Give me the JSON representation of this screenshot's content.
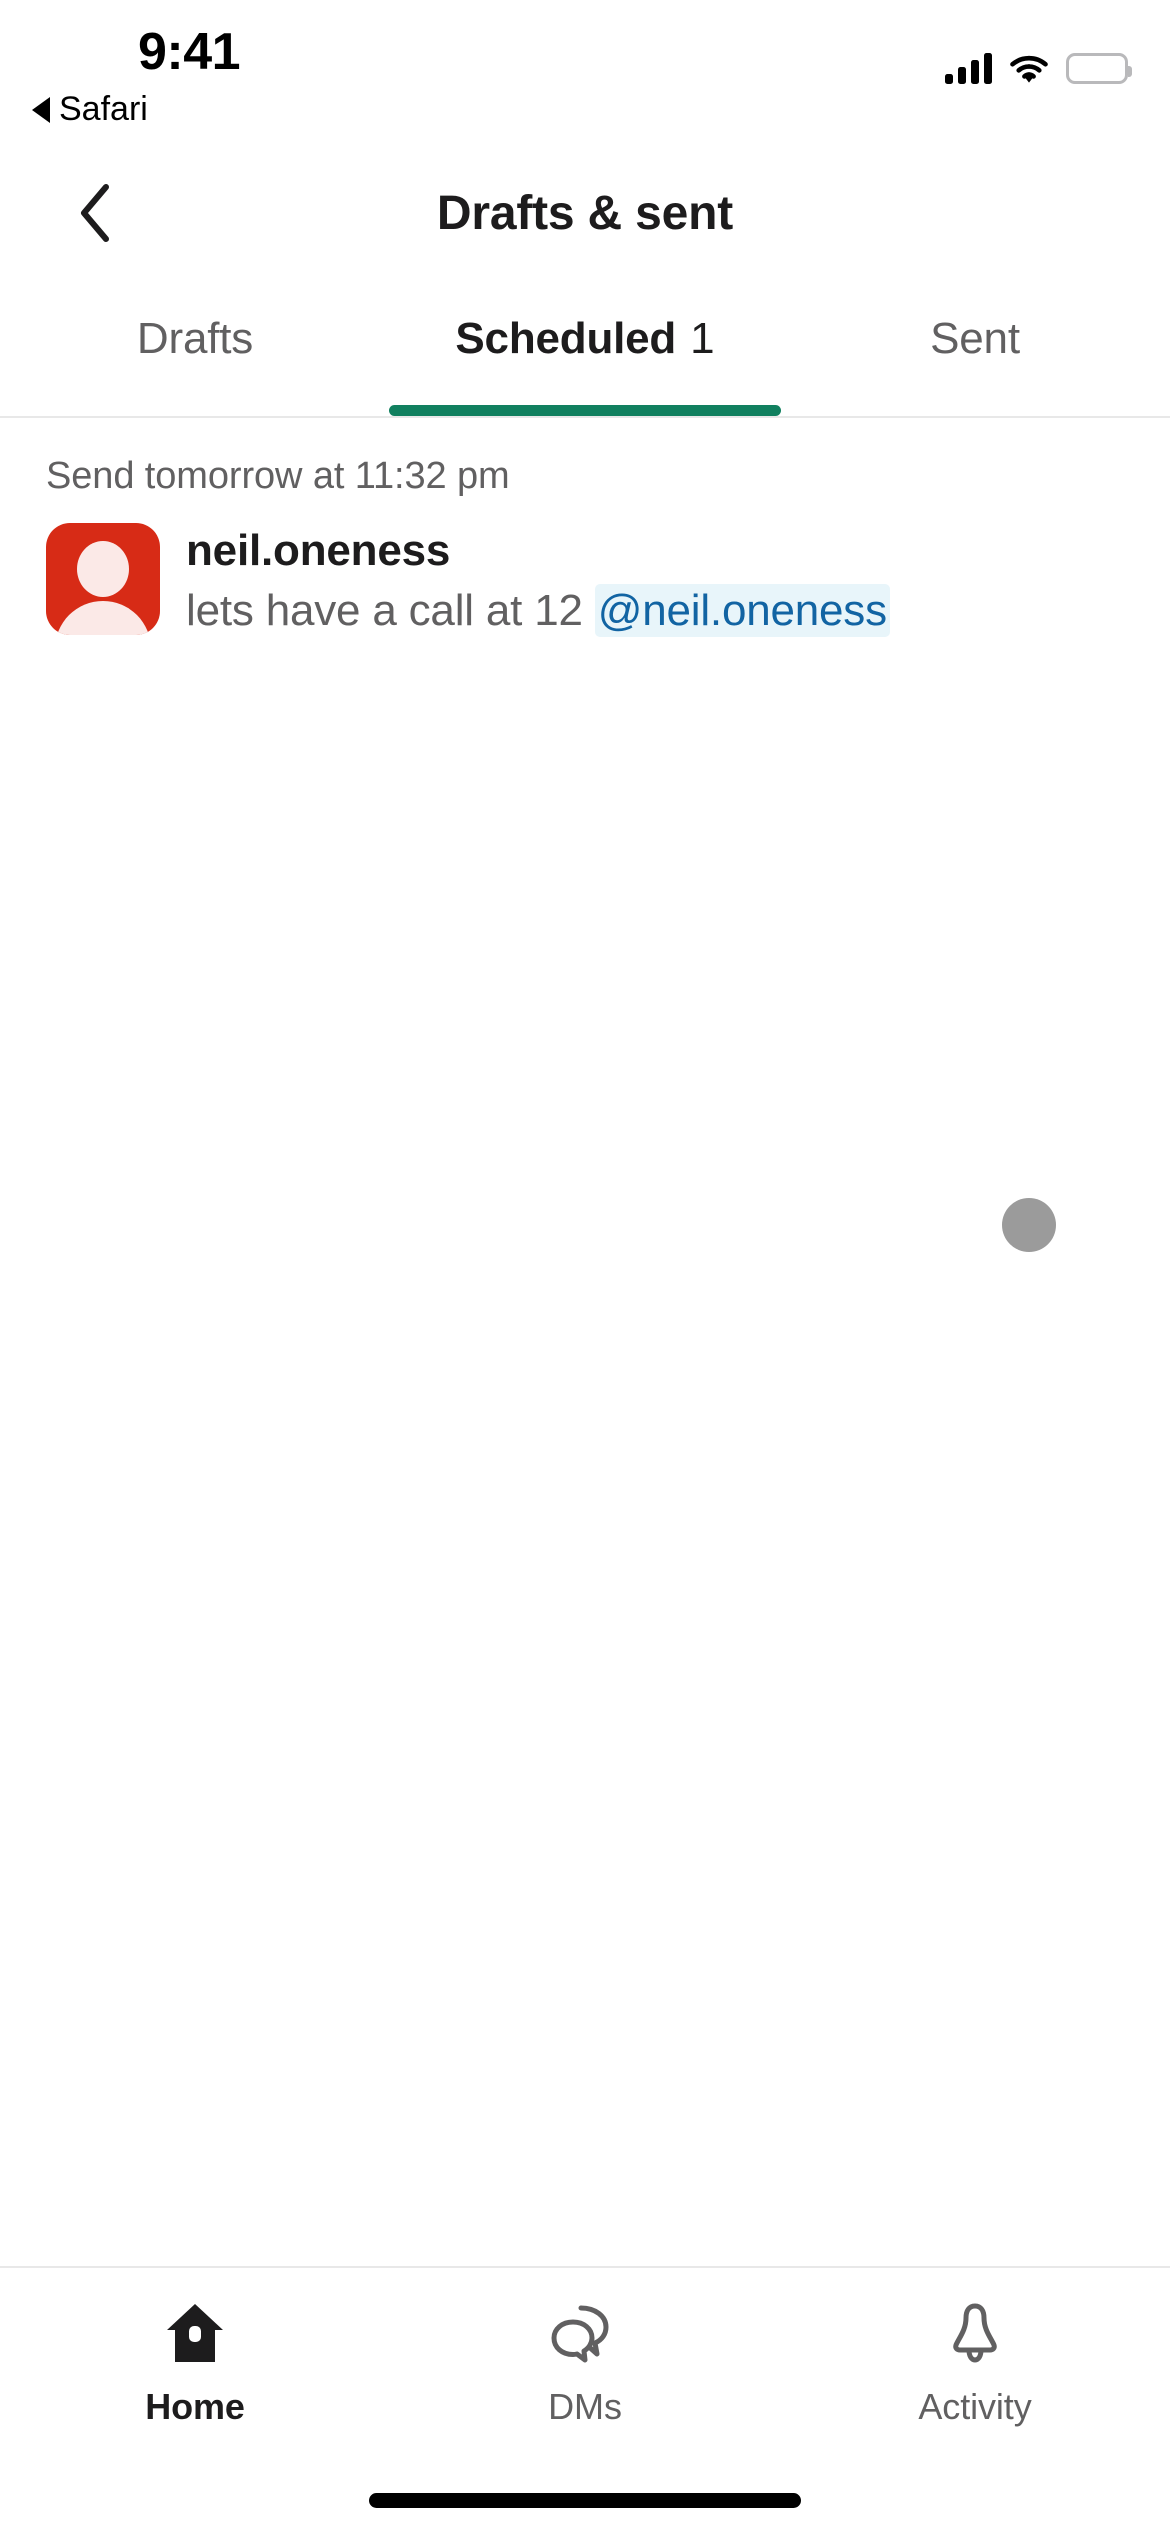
{
  "status_bar": {
    "time": "9:41",
    "back_app": "Safari",
    "back_icon": "triangle-left-icon",
    "signal_icon": "cellular-signal-icon",
    "signal_bars": 4,
    "wifi_icon": "wifi-icon",
    "battery_icon": "battery-full-icon",
    "battery_level": 100
  },
  "navbar": {
    "back_icon": "chevron-left-icon",
    "title": "Drafts & sent"
  },
  "tabs": {
    "active_index": 1,
    "accent_color": "#11805F",
    "items": [
      {
        "label": "Drafts",
        "count": ""
      },
      {
        "label": "Scheduled",
        "count": "1"
      },
      {
        "label": "Sent",
        "count": ""
      }
    ]
  },
  "list": {
    "scheduled_label": "Send tomorrow at 11:32 pm",
    "message": {
      "avatar_icon": "person-avatar-icon",
      "avatar_color": "#D72B16",
      "username": "neil.oneness",
      "text_before": "lets have a call at 12 ",
      "mention": "@neil.oneness",
      "mention_color": "#1264A3",
      "mention_background": "#E8F5FA"
    }
  },
  "touch_indicator": {
    "name": "touch-point-indicator",
    "color": "#9B9B9B"
  },
  "bottom_nav": {
    "active_index": 0,
    "items": [
      {
        "label": "Home",
        "icon": "home-icon"
      },
      {
        "label": "DMs",
        "icon": "speech-bubbles-icon"
      },
      {
        "label": "Activity",
        "icon": "bell-icon"
      }
    ]
  },
  "home_indicator": {
    "name": "home-indicator-bar"
  }
}
